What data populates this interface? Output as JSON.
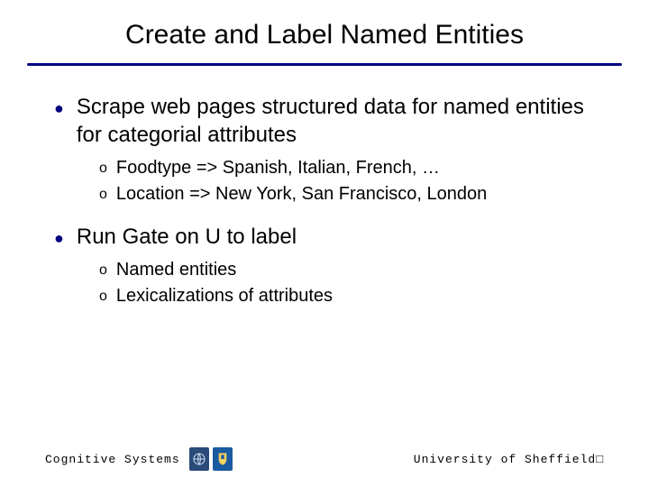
{
  "title": "Create and Label Named Entities",
  "bullets": [
    {
      "text": "Scrape web pages structured data for named entities for categorial attributes",
      "sub": [
        "Foodtype => Spanish, Italian, French, …",
        "Location => New York, San Francisco, London"
      ]
    },
    {
      "text": "Run Gate on U to label",
      "sub": [
        "Named entities",
        "Lexicalizations of attributes"
      ]
    }
  ],
  "footer": {
    "left": "Cognitive Systems",
    "right": "University of Sheffield□"
  }
}
